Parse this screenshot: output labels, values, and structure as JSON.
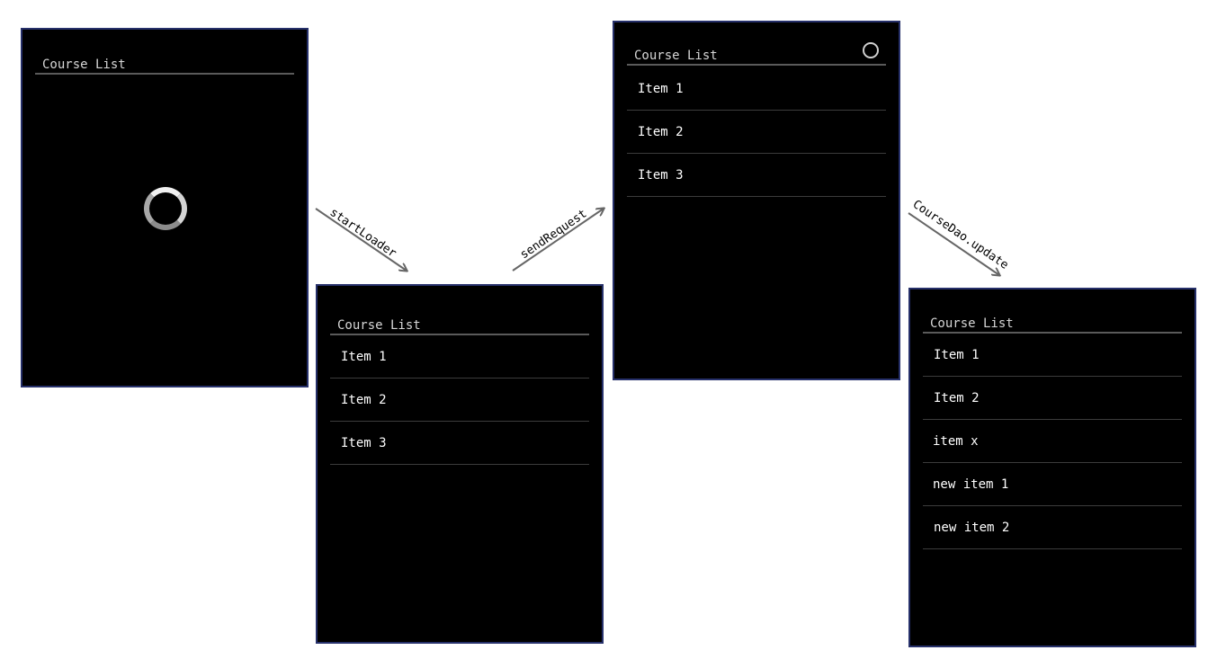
{
  "screens": [
    {
      "title": "Course List",
      "items": []
    },
    {
      "title": "Course List",
      "items": [
        "Item 1",
        "Item 2",
        "Item 3"
      ]
    },
    {
      "title": "Course List",
      "items": [
        "Item 1",
        "Item 2",
        "Item 3"
      ]
    },
    {
      "title": "Course List",
      "items": [
        "Item 1",
        "Item 2",
        "item x",
        "new item 1",
        "new item 2"
      ]
    }
  ],
  "transitions": [
    "startLoader",
    "sendRequest",
    "CourseDao.update"
  ],
  "colors": {
    "screen_bg": "#000000",
    "screen_border": "#26306a",
    "title_text": "#d6d6d6",
    "item_text": "#ffffff",
    "arrow": "#666666"
  }
}
